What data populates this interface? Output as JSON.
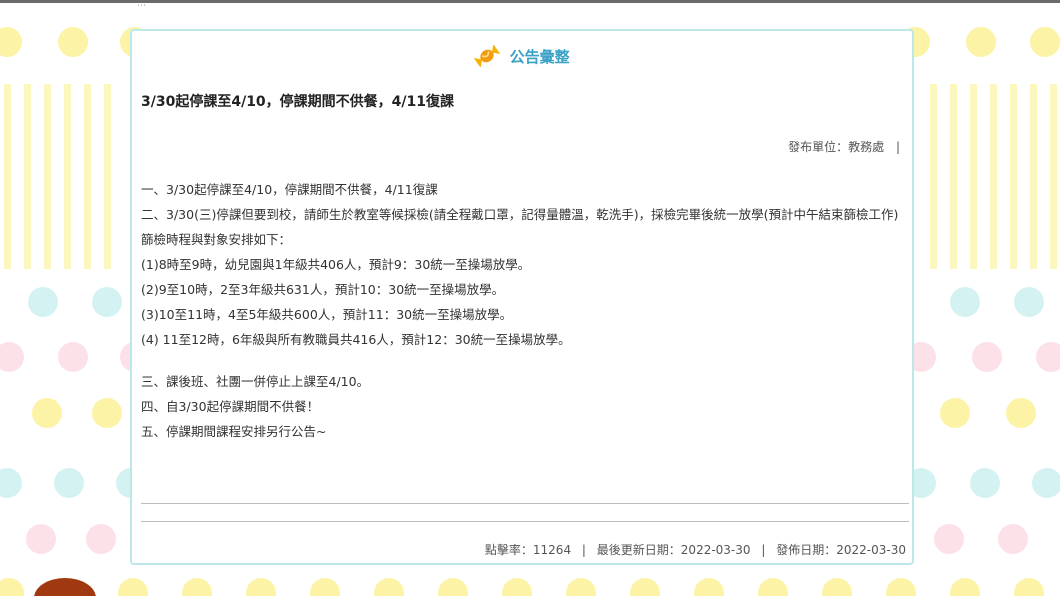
{
  "header": {
    "title": "公告彙整",
    "icon": "candy-icon"
  },
  "announcement": {
    "title": "3/30起停課至4/10，停課期間不供餐，4/11復課",
    "publisher_label": "發布單位：教務處",
    "publisher_sep": "|",
    "paragraphs": [
      "一、3/30起停課至4/10，停課期間不供餐，4/11復課",
      "二、3/30(三)停課但要到校，請師生於教室等候採檢(請全程戴口罩，記得量體溫，乾洗手)，採檢完畢後統一放學(預計中午結束篩檢工作)",
      "篩檢時程與對象安排如下：",
      "(1)8時至9時，幼兒園與1年級共406人，預計9：30統一至操場放學。",
      "(2)9至10時，2至3年級共631人，預計10：30統一至操場放學。",
      "(3)10至11時，4至5年級共600人，預計11：30統一至操場放學。",
      "(4) 11至12時，6年級與所有教職員共416人，預計12：30統一至操場放學。",
      "三、課後班、社團一併停止上課至4/10。",
      "四、自3/30起停課期間不供餐！",
      "五、停課期間課程安排另行公告~"
    ]
  },
  "footer": {
    "clicks": "點擊率：11264",
    "updated": "最後更新日期：2022-03-30",
    "published": "發佈日期：2022-03-30",
    "sep": "|"
  },
  "colors": {
    "accent": "#3aa1c7",
    "panel_border": "#bde8ea",
    "dot_yellow": "#fcf3a6",
    "dot_teal": "#d5f2f3",
    "dot_pink": "#fde1e8",
    "stripe": "#fcf6bf"
  }
}
